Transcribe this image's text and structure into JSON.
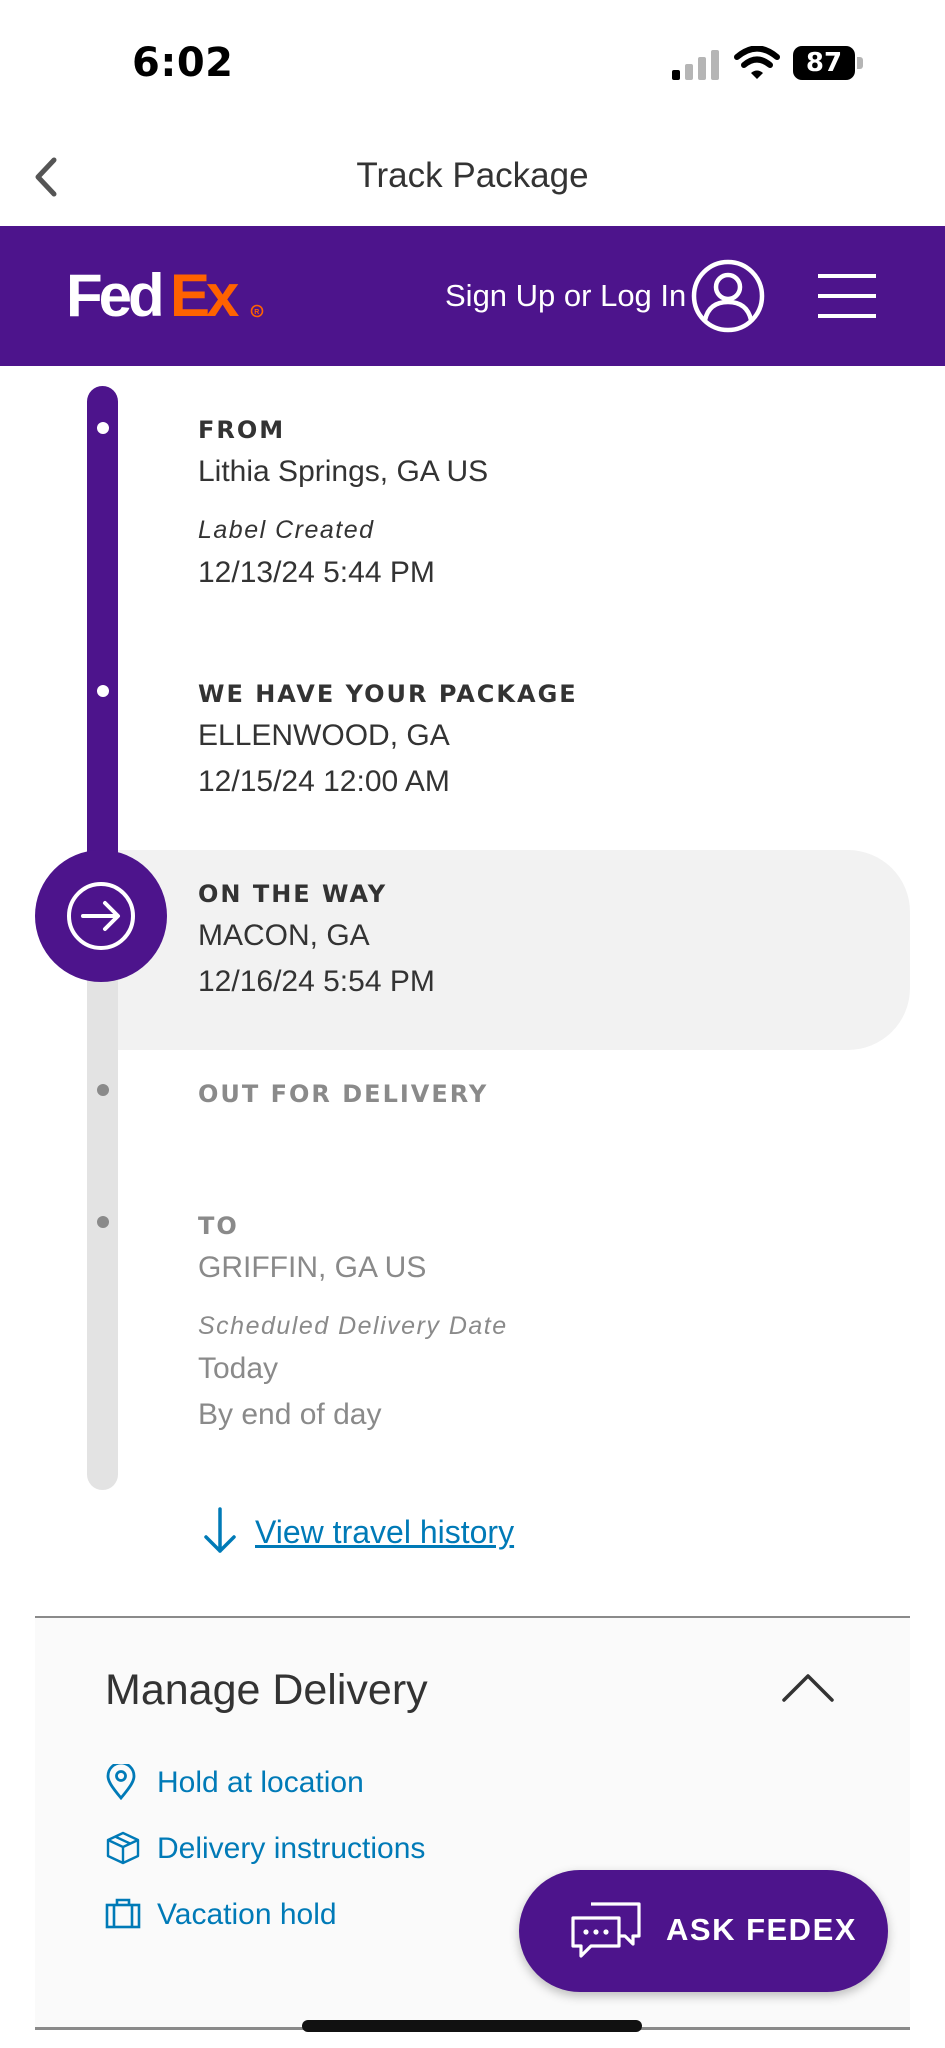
{
  "status_bar": {
    "time": "6:02",
    "battery": "87"
  },
  "nav": {
    "title": "Track Package"
  },
  "header": {
    "login_label": "Sign Up or Log In"
  },
  "timeline": {
    "from": {
      "label": "FROM",
      "location": "Lithia Springs, GA US",
      "event": "Label Created",
      "datetime": "12/13/24 5:44 PM"
    },
    "received": {
      "label": "WE HAVE YOUR PACKAGE",
      "location": "ELLENWOOD, GA",
      "datetime": "12/15/24 12:00 AM"
    },
    "on_the_way": {
      "label": "ON THE WAY",
      "location": "MACON, GA",
      "datetime": "12/16/24 5:54 PM"
    },
    "out_for_delivery": {
      "label": "OUT FOR DELIVERY"
    },
    "to": {
      "label": "TO",
      "location": "GRIFFIN, GA US",
      "event": "Scheduled Delivery Date",
      "day": "Today",
      "time": "By end of day"
    }
  },
  "travel_history": {
    "label": "View travel history"
  },
  "manage_delivery": {
    "title": "Manage Delivery",
    "actions": [
      {
        "label": "Hold at location",
        "icon": "location-pin-icon"
      },
      {
        "label": "Delivery instructions",
        "icon": "package-box-icon"
      },
      {
        "label": "Vacation hold",
        "icon": "suitcase-icon"
      }
    ]
  },
  "ask_fedex": {
    "label": "ASK FEDEX"
  },
  "colors": {
    "fedex_purple": "#4d148c",
    "fedex_orange": "#ff6200",
    "link_blue": "#007ab7",
    "muted_gray": "#8a8a8a"
  }
}
